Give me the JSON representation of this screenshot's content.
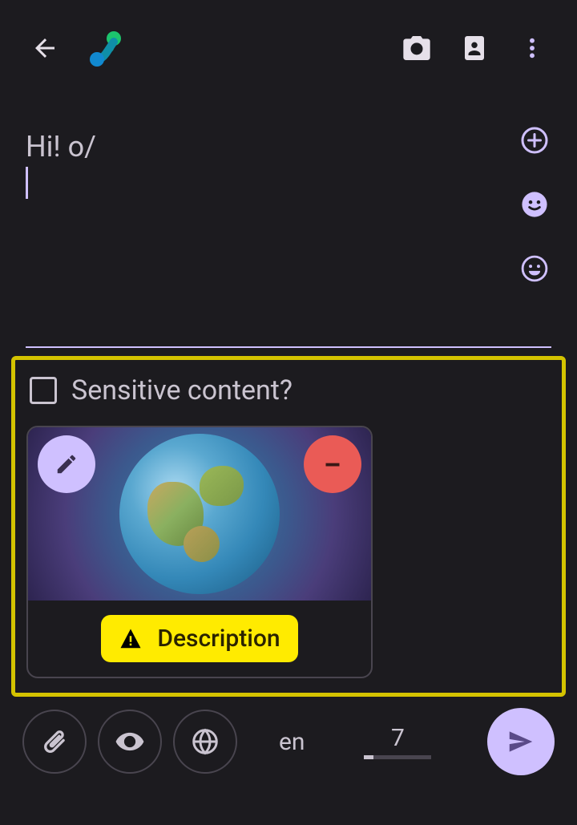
{
  "topbar": {
    "back": "back",
    "camera": "camera",
    "contact": "contact",
    "more": "more"
  },
  "compose": {
    "text": "Hi! o/",
    "actions": {
      "add": "add",
      "emoji_simple": "emoji",
      "emoji_grin": "grin"
    }
  },
  "attachments": {
    "sensitive_label": "Sensitive content?",
    "sensitive_checked": false,
    "items": [
      {
        "alt": "earth-watercolor",
        "edit_label": "edit",
        "remove_label": "remove",
        "description_button": "Description",
        "description_warning": true
      }
    ]
  },
  "footer": {
    "attach": "attach",
    "visibility": "visibility",
    "federation": "federation",
    "language": "en",
    "char_count": "7",
    "send": "send"
  }
}
